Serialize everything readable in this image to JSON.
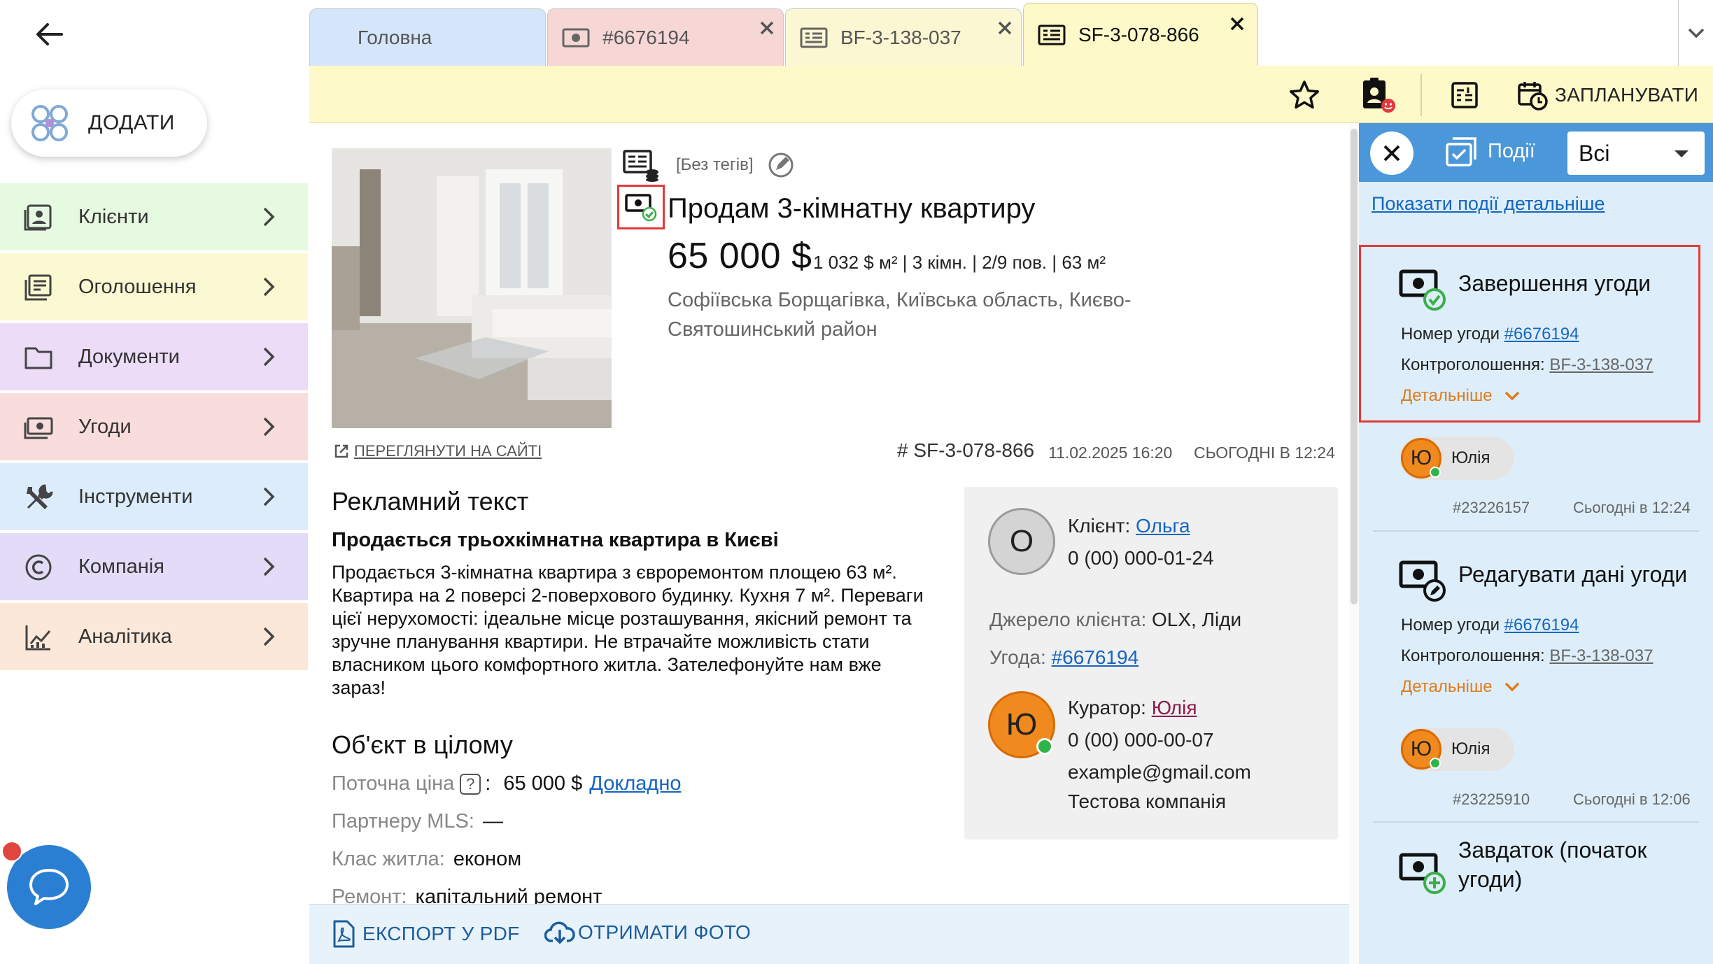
{
  "sidebar": {
    "add_label": "ДОДАТИ",
    "items": [
      {
        "label": "Клієнти",
        "color": "#e6f9e1"
      },
      {
        "label": "Оголошення",
        "color": "#fbf9d2"
      },
      {
        "label": "Документи",
        "color": "#ecdcf8"
      },
      {
        "label": "Угоди",
        "color": "#f9dcdc"
      },
      {
        "label": "Інструменти",
        "color": "#dcecfb"
      },
      {
        "label": "Компанія",
        "color": "#e3dcf8"
      },
      {
        "label": "Аналітика",
        "color": "#fbe8d9"
      }
    ]
  },
  "tabs": [
    {
      "label": "Головна",
      "color": "#d5e6fa"
    },
    {
      "label": "#6676194",
      "color": "#f7d6d6"
    },
    {
      "label": "BF-3-138-037",
      "color": "#fbf7d3"
    },
    {
      "label": "SF-3-078-866",
      "color": "#fef9c9"
    }
  ],
  "toolbar": {
    "schedule_label": "ЗАПЛАНУВАТИ"
  },
  "listing": {
    "tags": "[Без тегів]",
    "title": "Продам 3-кімнатну квартиру",
    "price": "65 000 $",
    "details": "1 032 $ м² | 3 кімн. | 2/9 пов. | 63 м²",
    "address": "Софіївська Борщагівка, Київська область, Києво-Святошинський район",
    "view_on_site": "ПЕРЕГЛЯНУТИ НА САЙТІ",
    "id": "# SF-3-078-866",
    "created": "11.02.2025 16:20",
    "updated": "СЬОГОДНІ В 12:24",
    "ad_heading": "Рекламний текст",
    "ad_subheading": "Продається трьохкімнатна квартира в Києві",
    "ad_text": "Продається 3-кімнатна квартира з євроремонтом площею 63 м². Квартира на 2 поверсі 2-поверхового будинку. Кухня 7 м². Переваги цієї нерухомості: ідеальне місце розташування, якісний ремонт та зручне планування квартири. Не втрачайте можливість стати власником цього комфортного житла. Зателефонуйте нам вже зараз!",
    "object_heading": "Об'єкт в цілому",
    "props": [
      {
        "key": "Поточна ціна",
        "help": "?",
        "sep": ":",
        "value": "65 000 $",
        "link": "Докладно"
      },
      {
        "key": "Партнеру MLS:",
        "value": "—"
      },
      {
        "key": "Клас житла:",
        "value": "економ"
      },
      {
        "key": "Ремонт:",
        "value": "капітальний ремонт"
      }
    ]
  },
  "contact": {
    "client_initial": "О",
    "client_key": "Клієнт:",
    "client_name": "Ольга",
    "client_phone": "0 (00) 000-01-24",
    "source_key": "Джерело клієнта:",
    "source_value": "OLX, Ліди",
    "deal_key": "Угода:",
    "deal_value": "#6676194",
    "curator_initial": "Ю",
    "curator_key": "Куратор:",
    "curator_name": "Юлія",
    "curator_phone": "0 (00) 000-00-07",
    "curator_email": "example@gmail.com",
    "curator_company": "Тестова компанія"
  },
  "bottom": {
    "export_pdf": "ЕКСПОРТ У PDF",
    "get_photos": "ОТРИМАТИ ФОТО"
  },
  "events": {
    "title": "Події",
    "filter": "Всі",
    "show_detailed": "Показати події детальніше",
    "items": [
      {
        "title": "Завершення угоди",
        "deal_key": "Номер угоди",
        "deal_value": "#6676194",
        "counter_key": "Контроголошення:",
        "counter_value": "BF-3-138-037",
        "more": "Детальніше",
        "user_initial": "Ю",
        "user": "Юлія",
        "id": "#23226157",
        "time": "Сьогодні в 12:24"
      },
      {
        "title": "Редагувати дані угоди",
        "deal_key": "Номер угоди",
        "deal_value": "#6676194",
        "counter_key": "Контроголошення:",
        "counter_value": "BF-3-138-037",
        "more": "Детальніше",
        "user_initial": "Ю",
        "user": "Юлія",
        "id": "#23225910",
        "time": "Сьогодні в 12:06"
      },
      {
        "title_line1": "Завдаток (початок",
        "title_line2": "угоди)"
      }
    ]
  },
  "colors": {
    "accent_blue": "#4a97d9",
    "link_blue": "#1565c0",
    "highlight_red": "#e23a3a",
    "avatar_orange": "#f08a1e",
    "online_green": "#2db54a",
    "more_orange": "#e07b1c"
  }
}
